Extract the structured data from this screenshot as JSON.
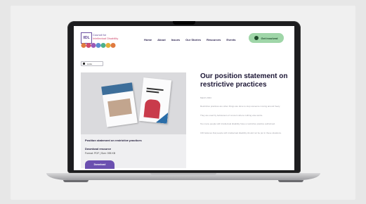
{
  "site": {
    "logo": {
      "mark": "IIDL",
      "line1": "Council for",
      "line2": "Intellectual Disability"
    },
    "nav": [
      "Home",
      "About",
      "Issues",
      "Our Stories",
      "Resources",
      "Events"
    ],
    "cta_label": "Get involved"
  },
  "toolbar": {
    "label": "Links"
  },
  "resource_card": {
    "title": "Position statement on restrictive practices",
    "subtitle": "Download resource",
    "meta": "Format: PDF | Size: 995 KB",
    "button_label": "Download"
  },
  "article": {
    "title": "Our position statement on restrictive practices",
    "date": "March 2024",
    "paragraphs": [
      "Restrictive practices are when things are done to stop someone moving around freely.",
      "They are used by behaviours of concern where nothing else works.",
      "Too many people with intellectual disability have a restrictive practice authorised.",
      "CID believes that people with intellectual disability should not be put in these situations."
    ]
  },
  "colors": {
    "brand_purple": "#6b4fb0",
    "cta_green": "#9fd6a8",
    "heading": "#1d1736"
  }
}
